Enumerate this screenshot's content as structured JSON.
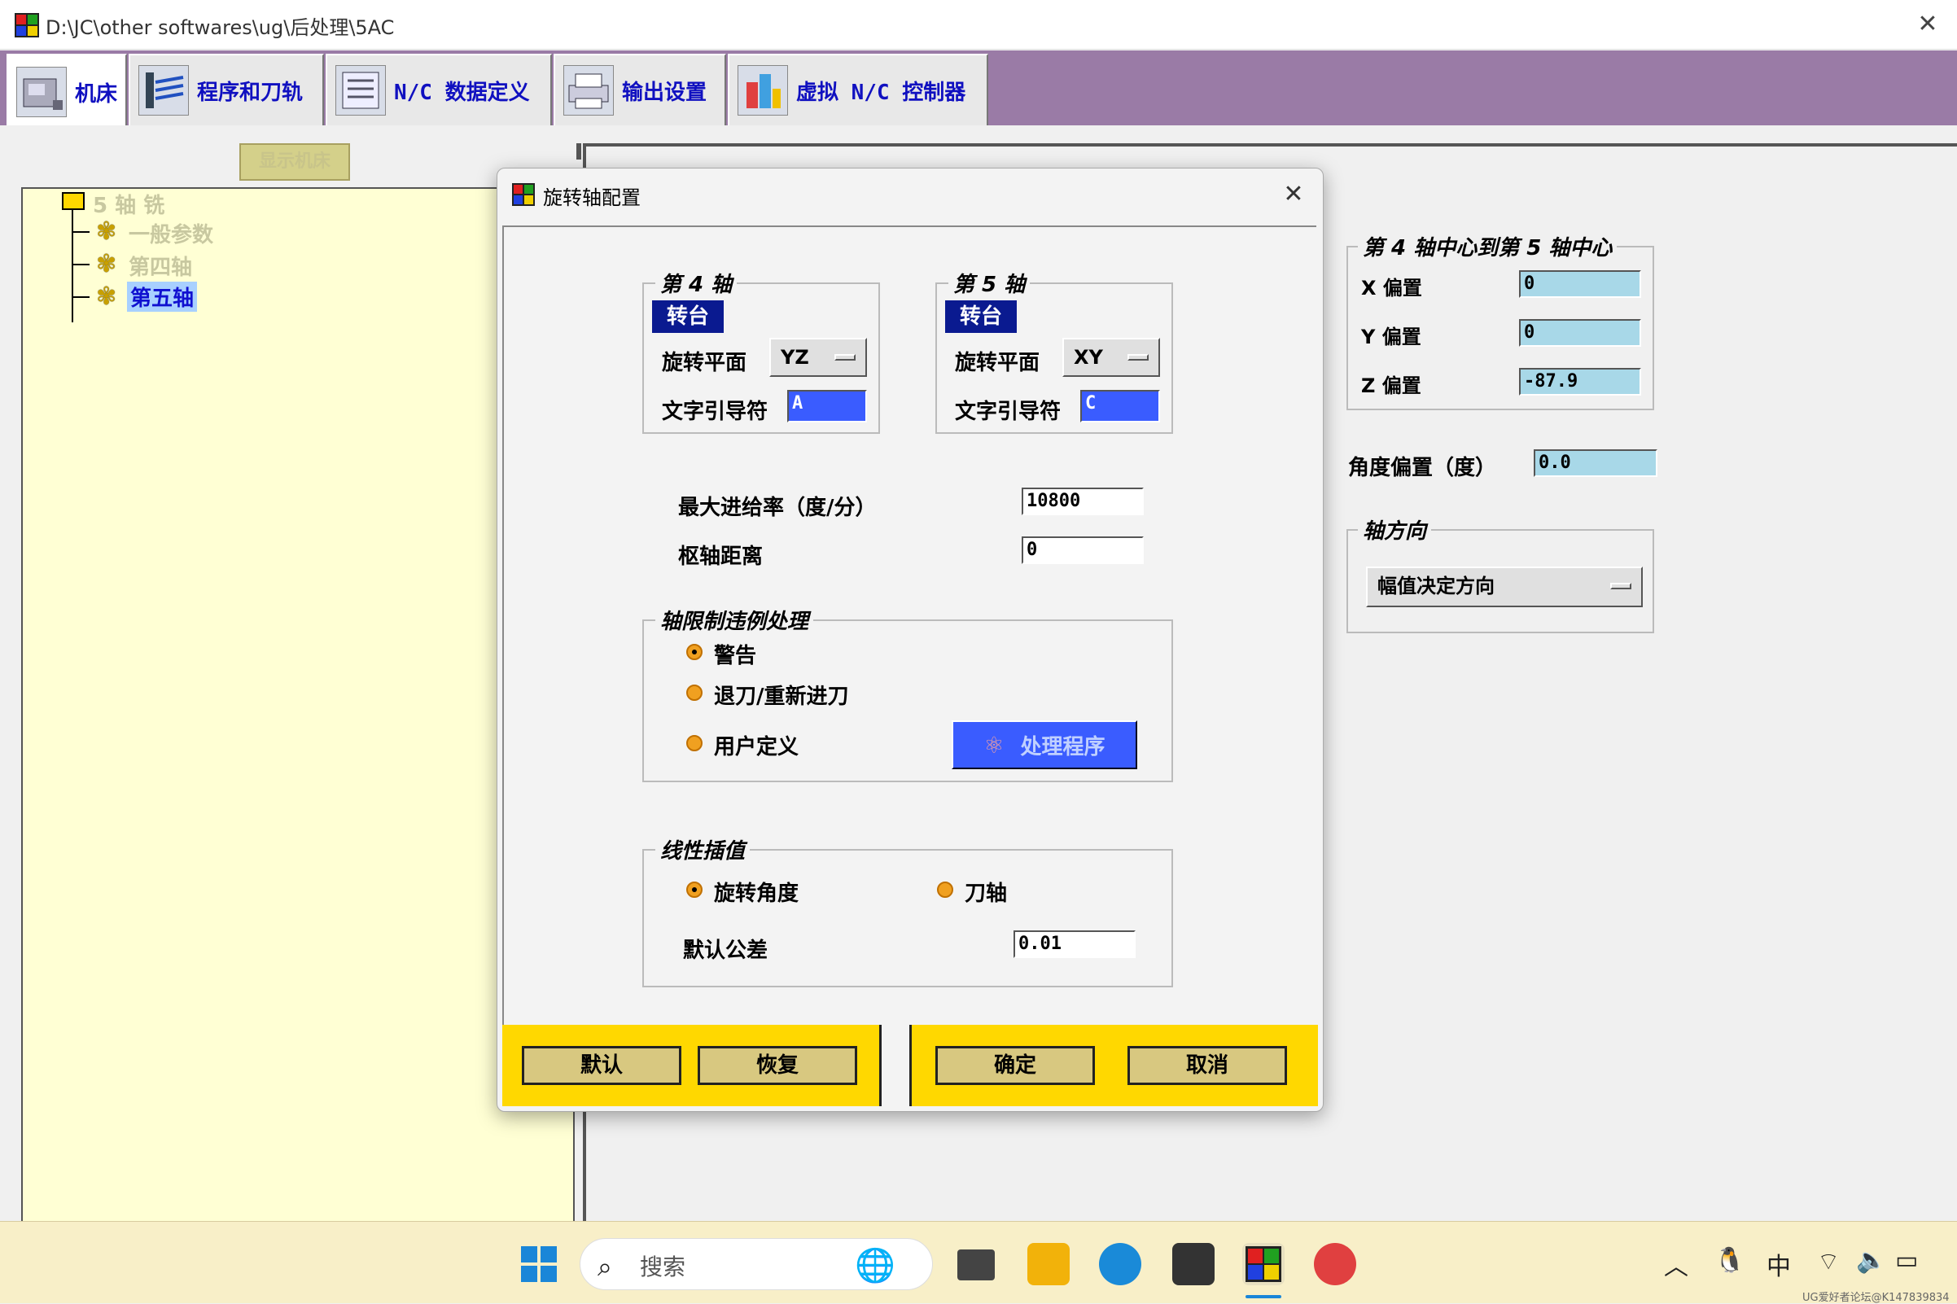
{
  "window": {
    "title": "D:\\JC\\other softwares\\ug\\后处理\\5AC",
    "close_glyph": "✕"
  },
  "tabs": [
    {
      "label": "机床",
      "icon": "machine-icon"
    },
    {
      "label": "程序和刀轨",
      "icon": "program-toolpath-icon"
    },
    {
      "label": "N/C 数据定义",
      "icon": "nc-data-icon"
    },
    {
      "label": "输出设置",
      "icon": "printer-icon"
    },
    {
      "label": "虚拟 N/C 控制器",
      "icon": "virtual-controller-icon"
    }
  ],
  "show_machine_button": "显示机床",
  "tree": {
    "root": "5 轴 铣",
    "items": [
      "一般参数",
      "第四轴",
      "第五轴"
    ],
    "selected": "第五轴"
  },
  "right_panel": {
    "center_group": {
      "legend": "第 4 轴中心到第 5 轴中心",
      "x_label": "X 偏置",
      "x_value": "0",
      "y_label": "Y 偏置",
      "y_value": "0",
      "z_label": "Z 偏置",
      "z_value": "-87.9"
    },
    "angle_offset_label": "角度偏置（度）",
    "angle_offset_value": "0.0",
    "axis_dir_group": {
      "legend": "轴方向",
      "combo_value": "幅值决定方向"
    }
  },
  "dialog": {
    "title": "旋转轴配置",
    "close_glyph": "✕",
    "axis4": {
      "legend": "第 4 轴",
      "type": "转台",
      "plane_label": "旋转平面",
      "plane_value": "YZ",
      "leader_label": "文字引导符",
      "leader_value": "A"
    },
    "axis5": {
      "legend": "第 5 轴",
      "type": "转台",
      "plane_label": "旋转平面",
      "plane_value": "XY",
      "leader_label": "文字引导符",
      "leader_value": "C"
    },
    "max_feed_label": "最大进给率（度/分）",
    "max_feed_value": "10800",
    "pivot_label": "枢轴距离",
    "pivot_value": "0",
    "limit_group": {
      "legend": "轴限制违例处理",
      "options": [
        "警告",
        "退刀/重新进刀",
        "用户定义"
      ],
      "selected": "警告",
      "process_button": "处理程序"
    },
    "linear_group": {
      "legend": "线性插值",
      "options": [
        "旋转角度",
        "刀轴"
      ],
      "selected": "旋转角度",
      "tolerance_label": "默认公差",
      "tolerance_value": "0.01"
    },
    "buttons": {
      "default": "默认",
      "restore": "恢复",
      "ok": "确定",
      "cancel": "取消"
    }
  },
  "taskbar": {
    "search_placeholder": "搜索",
    "ime": "中",
    "watermark": "UG爱好者论坛@K147839834"
  },
  "colors": {
    "tabbar": "#9a7ba6",
    "tree_bg": "#ffffd4",
    "dialog_bar": "#ffd800",
    "field_cyan": "#a8d8e8",
    "field_blue": "#3a5cff",
    "badge_navy": "#0a1a90"
  }
}
